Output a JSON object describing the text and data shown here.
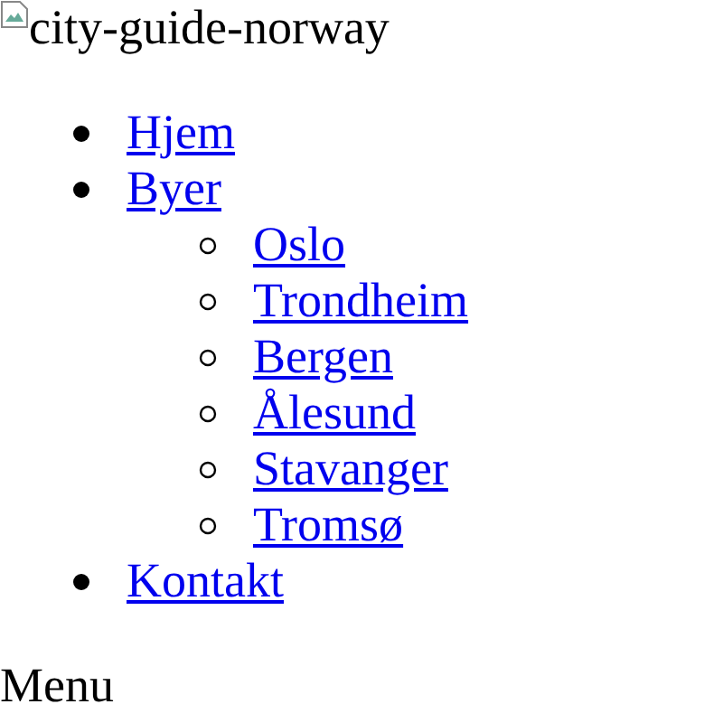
{
  "logo": {
    "alt": "city-guide-norway"
  },
  "nav": [
    {
      "label": "Hjem"
    },
    {
      "label": "Byer",
      "children": [
        {
          "label": "Oslo"
        },
        {
          "label": "Trondheim"
        },
        {
          "label": "Bergen"
        },
        {
          "label": "Ålesund"
        },
        {
          "label": "Stavanger"
        },
        {
          "label": "Tromsø"
        }
      ]
    },
    {
      "label": "Kontakt"
    }
  ],
  "menu_label": "Menu"
}
